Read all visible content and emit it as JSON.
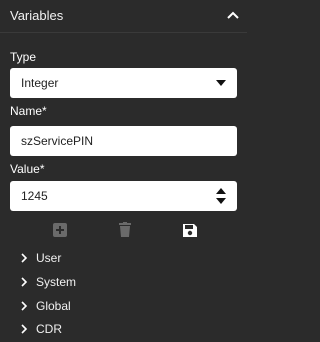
{
  "header": {
    "title": "Variables"
  },
  "fields": {
    "type": {
      "label": "Type",
      "value": "Integer"
    },
    "name": {
      "label": "Name",
      "required_mark": "*",
      "value": "szServicePIN"
    },
    "value": {
      "label": "Value",
      "required_mark": "*",
      "value": "1245"
    }
  },
  "actions": {
    "add": {
      "icon": "plus-square-icon",
      "enabled": false
    },
    "delete": {
      "icon": "trash-icon",
      "enabled": false
    },
    "save": {
      "icon": "save-icon",
      "enabled": true
    }
  },
  "tree": [
    {
      "label": "User"
    },
    {
      "label": "System"
    },
    {
      "label": "Global"
    },
    {
      "label": "CDR"
    }
  ],
  "colors": {
    "background": "#2b2b2b",
    "input_background": "#ffffff",
    "disabled_icon": "#6a6a6a",
    "enabled_icon": "#ffffff"
  }
}
